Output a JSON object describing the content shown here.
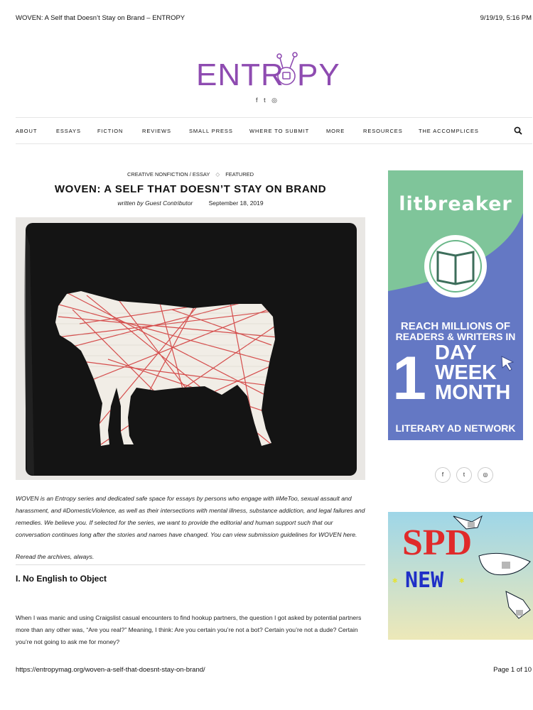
{
  "print": {
    "title": "WOVEN: A Self that Doesn’t Stay on Brand – ENTROPY",
    "datetime": "9/19/19, 5:16 PM",
    "url": "https://entropymag.org/woven-a-self-that-doesnt-stay-on-brand/",
    "page": "Page 1 of 10"
  },
  "logo": {
    "text": "ENTROPY",
    "color": "#8e4bb1"
  },
  "social_top": {
    "facebook": "f",
    "twitter": "t",
    "instagram": "◎"
  },
  "nav": {
    "items": [
      "ABOUT",
      "ESSAYS",
      "FICTION",
      "REVIEWS",
      "SMALL PRESS",
      "WHERE TO SUBMIT",
      "MORE",
      "RESOURCES",
      "THE ACCOMPLICES"
    ],
    "search_icon": "search-icon"
  },
  "post": {
    "category": "CREATIVE NONFICTION / ESSAY",
    "tag": "FEATURED",
    "title": "WOVEN: A SELF THAT DOESN’T STAY ON BRAND",
    "author": "written by Guest Contributor",
    "date": "September 18, 2019",
    "intro": "WOVEN is an Entropy series and dedicated safe space for essays by persons who engage with #MeToo, sexual assault and harassment, and #DomesticViolence, as well as their intersections with mental illness, substance addiction, and legal failures and remedies. We believe you. If selected for the series, we want to provide the editorial and human support such that our conversation continues long after the stories and names have changed. You can view submission guidelines for WOVEN here.",
    "reread": "Reread the archives, always.",
    "section_title": "I. No English to Object",
    "body": "When I was manic and using Craigslist casual encounters to find hookup partners, the question I got asked by potential partners more than any other was, “Are you real?” Meaning, I think: Are you certain you’re not a bot? Certain you’re not a dude? Certain you’re not going to ask me for money?"
  },
  "ad_litbreaker": {
    "brand": "litbreaker",
    "line1": "REACH MILLIONS OF",
    "line2": "READERS & WRITERS IN",
    "big_number": "1",
    "day": "DAY",
    "week": "WEEK",
    "month": "MONTH",
    "footer": "LITERARY AD NETWORK",
    "colors": {
      "green": "#7fc59a",
      "blue": "#6478c4"
    }
  },
  "ad_spd": {
    "brand": "SPD",
    "label": "NEW",
    "colors": {
      "red": "#e02a2a",
      "blue": "#1f2fc7",
      "sky": "#9ed6e8"
    }
  },
  "social_side": {
    "facebook": "f",
    "twitter": "t",
    "instagram": "◎"
  }
}
